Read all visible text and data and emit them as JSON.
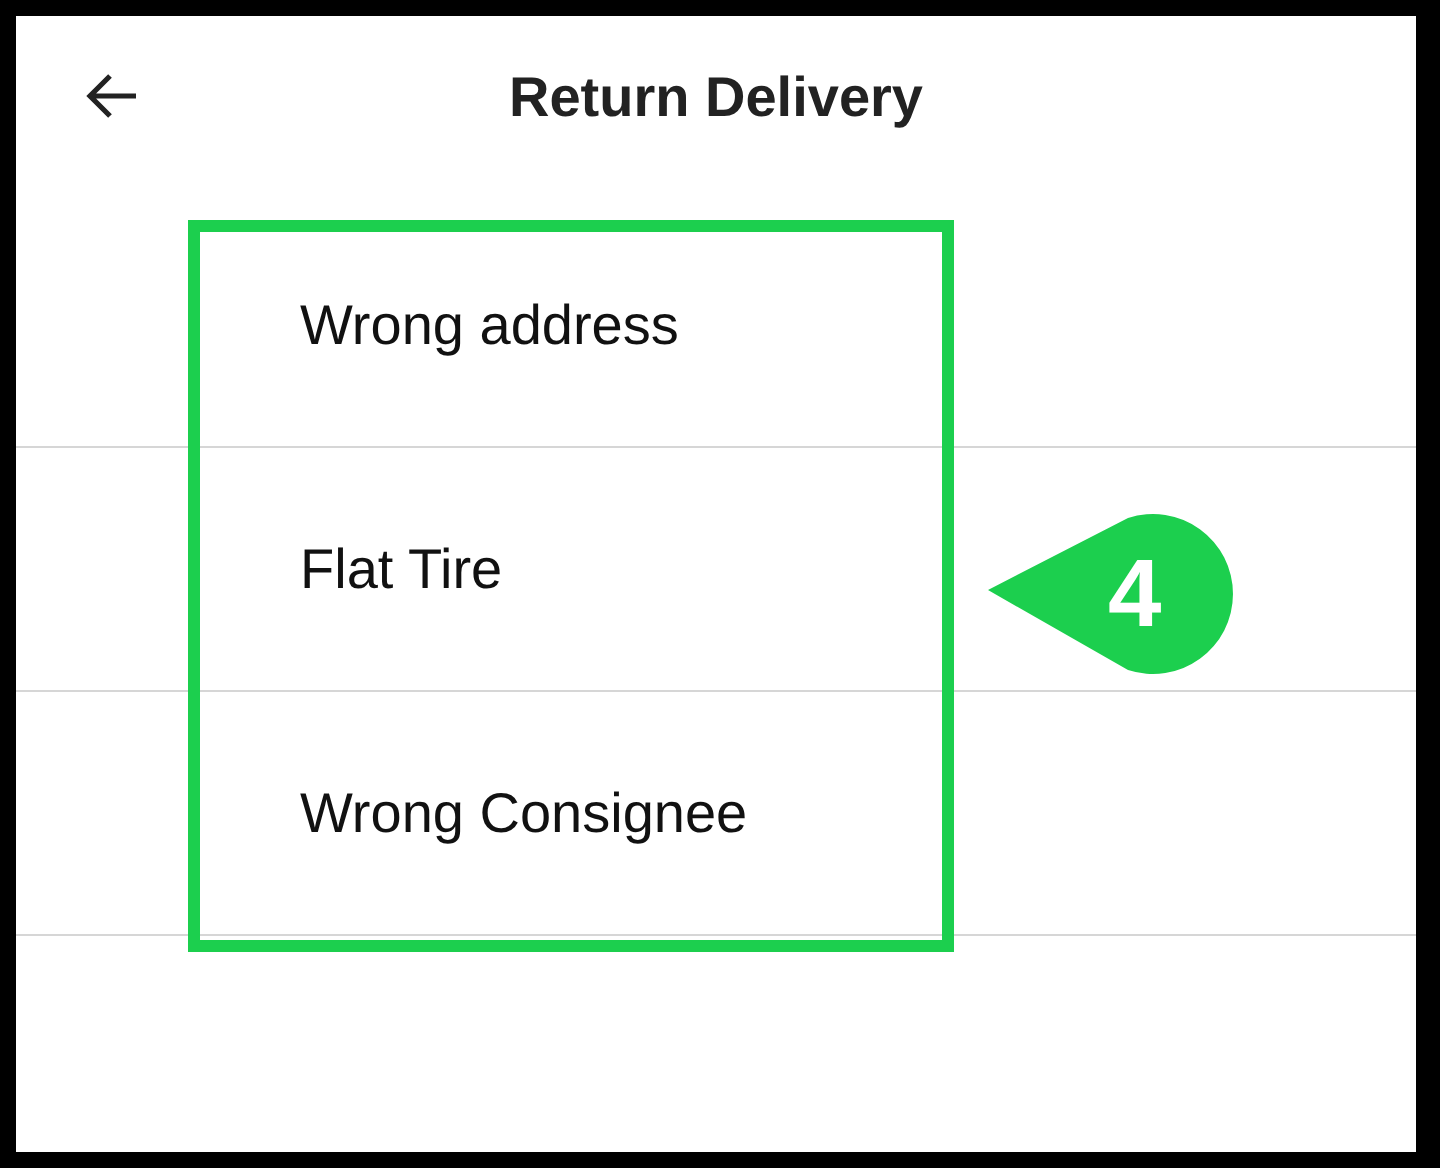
{
  "header": {
    "title": "Return Delivery"
  },
  "reasons": [
    {
      "label": "Wrong address"
    },
    {
      "label": "Flat Tire"
    },
    {
      "label": "Wrong Consignee"
    }
  ],
  "annotation": {
    "number": "4"
  }
}
